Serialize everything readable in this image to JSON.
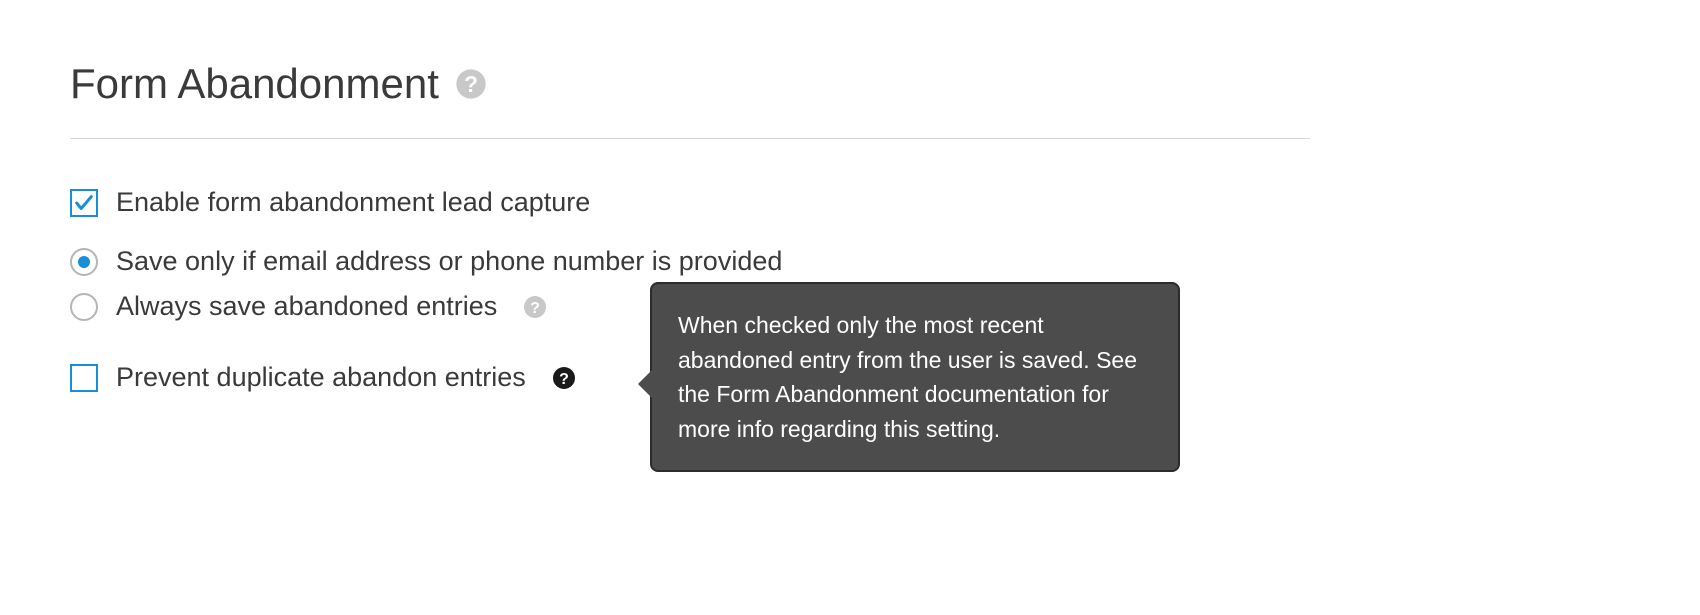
{
  "header": {
    "title": "Form Abandonment"
  },
  "options": {
    "enable_capture": {
      "label": "Enable form abandonment lead capture",
      "checked": true
    },
    "save_mode": {
      "save_if_contact": {
        "label": "Save only if email address or phone number is provided",
        "selected": true
      },
      "always_save": {
        "label": "Always save abandoned entries",
        "selected": false
      }
    },
    "prevent_duplicates": {
      "label": "Prevent duplicate abandon entries",
      "checked": false
    }
  },
  "tooltip": {
    "text": "When checked only the most recent abandoned entry from the user is saved. See the Form Abandonment documentation for more info regarding this setting."
  }
}
